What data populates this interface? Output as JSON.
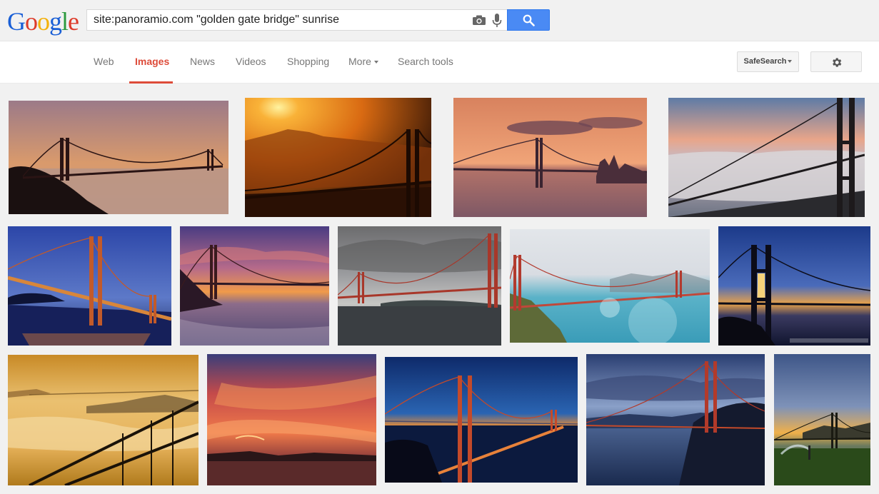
{
  "header": {
    "logo_letters": [
      {
        "char": "G",
        "color": "#1a5fd6"
      },
      {
        "char": "o",
        "color": "#dd3b2a"
      },
      {
        "char": "o",
        "color": "#f3b10b"
      },
      {
        "char": "g",
        "color": "#1a5fd6"
      },
      {
        "char": "l",
        "color": "#2c9a3f"
      },
      {
        "char": "e",
        "color": "#dd3b2a"
      }
    ],
    "search_query": "site:panoramio.com \"golden gate bridge\" sunrise",
    "camera_icon": "camera-icon",
    "mic_icon": "microphone-icon",
    "search_button_icon": "magnifier-icon",
    "accent_color": "#4a8af4"
  },
  "nav": {
    "tabs": [
      {
        "label": "Web",
        "active": false
      },
      {
        "label": "Images",
        "active": true
      },
      {
        "label": "News",
        "active": false
      },
      {
        "label": "Videos",
        "active": false
      },
      {
        "label": "Shopping",
        "active": false
      },
      {
        "label": "More",
        "active": false
      },
      {
        "label": "Search tools",
        "active": false
      }
    ],
    "safesearch_label": "SafeSearch",
    "settings_icon": "gear-icon",
    "active_color": "#dd4b39"
  },
  "results": {
    "images": [
      {
        "theme": "misty-dusk-silhouette"
      },
      {
        "theme": "orange-sun-city"
      },
      {
        "theme": "peach-clouds-far"
      },
      {
        "theme": "fog-tower-closeup"
      },
      {
        "theme": "blue-hour-lit-bridge"
      },
      {
        "theme": "purple-clouds-beach"
      },
      {
        "theme": "grey-overcast-red-bridge"
      },
      {
        "theme": "turquoise-water-flare"
      },
      {
        "theme": "tower-backlit-dusk"
      },
      {
        "theme": "golden-fog-cables"
      },
      {
        "theme": "red-cloud-sky"
      },
      {
        "theme": "blue-dusk-lit-bridge"
      },
      {
        "theme": "blue-clouds-tower"
      },
      {
        "theme": "sunrise-field-sprinkler"
      }
    ]
  }
}
